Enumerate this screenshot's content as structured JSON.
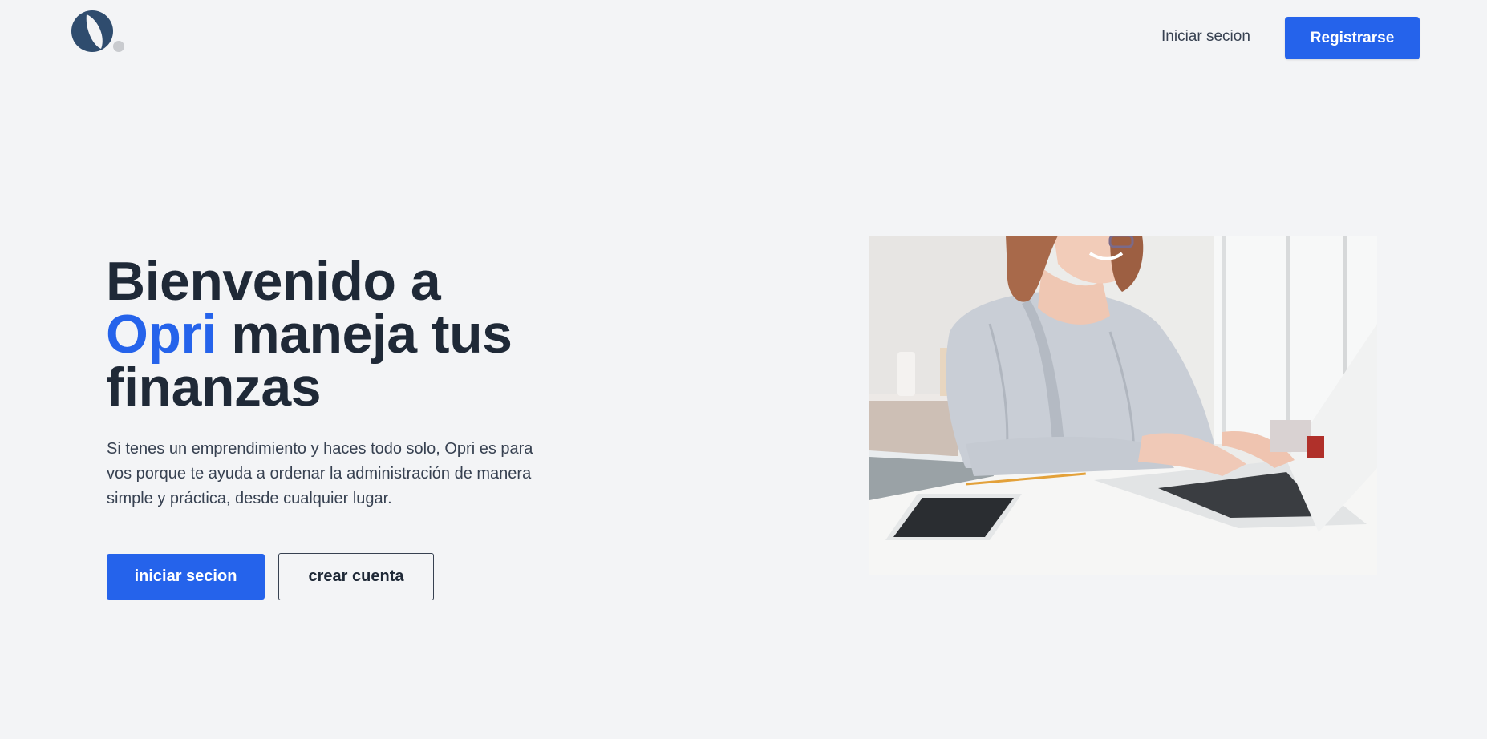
{
  "header": {
    "logo_icon": "opri-logo-icon",
    "login_label": "Iniciar secion",
    "register_label": "Registrarse"
  },
  "hero": {
    "title_line1": "Bienvenido a",
    "title_brand": "Opri",
    "title_line2_rest": " maneja tus",
    "title_line3": "finanzas",
    "description": "Si tenes un emprendimiento y haces todo solo, Opri es para vos porque te ayuda a ordenar la administración de manera simple y práctica, desde cualquier lugar.",
    "primary_button": "iniciar secion",
    "secondary_button": "crear cuenta",
    "image_icon": "woman-typing-laptop-photo"
  },
  "colors": {
    "accent": "#2563eb",
    "background": "#f3f4f6",
    "text": "#1f2937",
    "logo": "#2f4c6e"
  }
}
